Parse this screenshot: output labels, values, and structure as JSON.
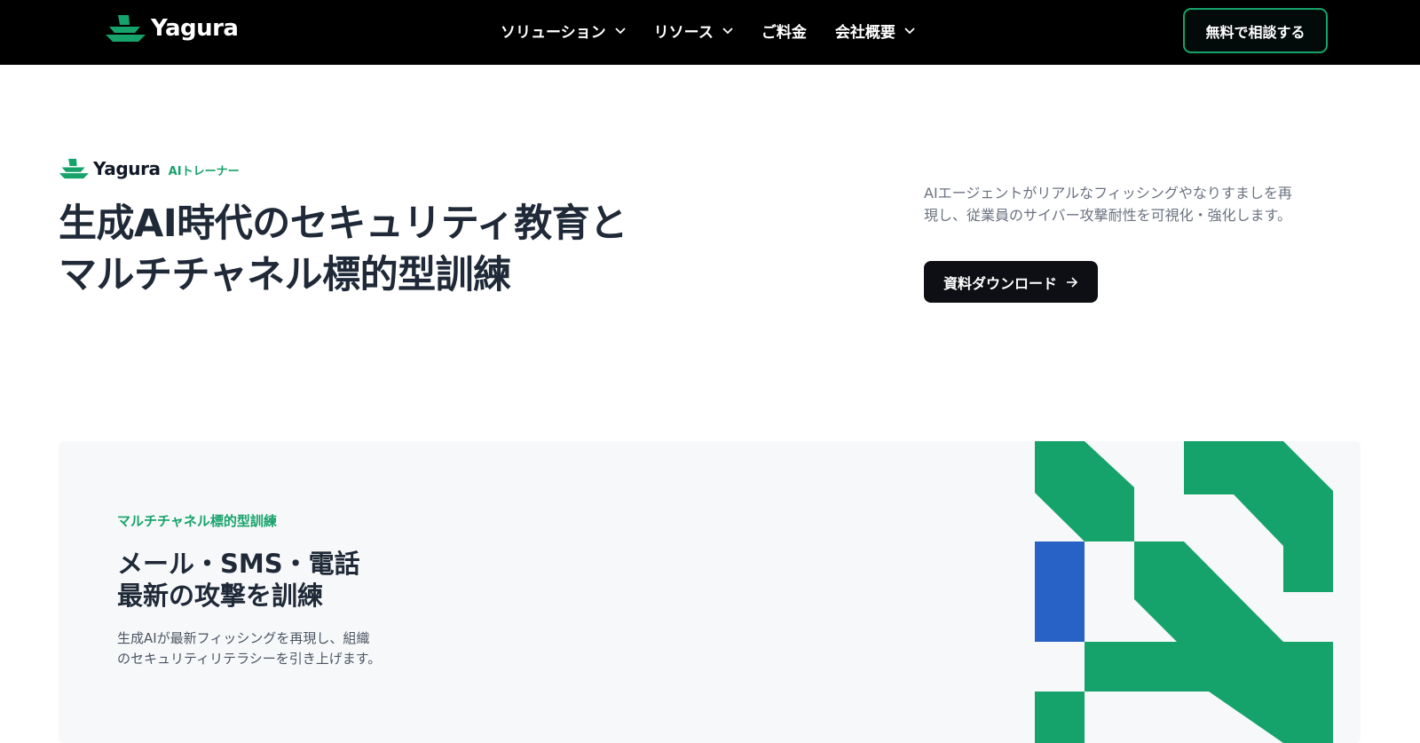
{
  "header": {
    "brand": "Yagura",
    "nav": [
      {
        "label": "ソリューション",
        "has_dropdown": true
      },
      {
        "label": "リソース",
        "has_dropdown": true
      },
      {
        "label": "ご料金",
        "has_dropdown": false
      },
      {
        "label": "会社概要",
        "has_dropdown": true
      }
    ],
    "cta_label": "無料で相談する"
  },
  "hero": {
    "logo_name": "Yagura",
    "logo_tag": "AIトレーナー",
    "title_lines": [
      "生成AI時代のセキュリティ教育と",
      "マルチチャネル標的型訓練"
    ],
    "description_lines": [
      "AIエージェントがリアルなフィッシングやなりすましを再",
      "現し、従業員のサイバー攻撃耐性を可視化・強化します。"
    ],
    "download_label": "資料ダウンロード"
  },
  "feature": {
    "eyebrow": "マルチチャネル標的型訓練",
    "title_lines": [
      "メール・SMS・電話",
      "最新の攻撃を訓練"
    ],
    "description_lines": [
      "生成AIが最新フィッシングを再現し、組織",
      "のセキュリティリテラシーを引き上げます。"
    ]
  },
  "icons": {
    "logo": "yagura-logo-icon",
    "chevron": "chevron-down-icon",
    "arrow": "arrow-right-icon"
  },
  "colors": {
    "brand_green": "#16a36b",
    "accent_blue": "#2962c6",
    "nav_bg": "#000000",
    "button_dark": "#0d0f14",
    "card_bg": "#f7f8fa"
  }
}
